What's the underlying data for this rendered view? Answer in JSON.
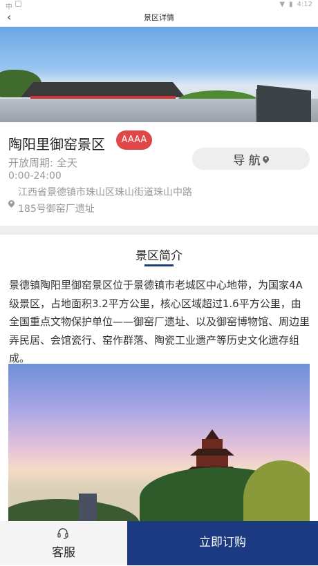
{
  "status_bar": {
    "time": "4:12"
  },
  "header": {
    "title": "景区详情"
  },
  "banner": {
    "slides": 3,
    "active_slide": 1
  },
  "spot": {
    "name": "陶阳里御窑景区",
    "level": "AAAA",
    "open_period": "开放周期: 全天",
    "open_hours": "0:00-24:00",
    "address": "江西省景德镇市珠山区珠山街道珠山中路185号御窑厂遗址",
    "nav_label": "导 航"
  },
  "intro": {
    "title": "景区简介",
    "text": "景德镇陶阳里御窑景区位于景德镇市老城区中心地带，为国家4A级景区，占地面积3.2平方公里，核心区域超过1.6平方公里，由全国重点文物保护单位——御窑厂遗址、以及御窑博物馆、周边里弄民居、会馆瓷行、窑作群落、陶瓷工业遗产等历史文化遗存组成。"
  },
  "bottom": {
    "service_label": "客服",
    "order_label": "立即订购"
  },
  "colors": {
    "accent": "#1b3a82",
    "badge": "#e04848"
  }
}
